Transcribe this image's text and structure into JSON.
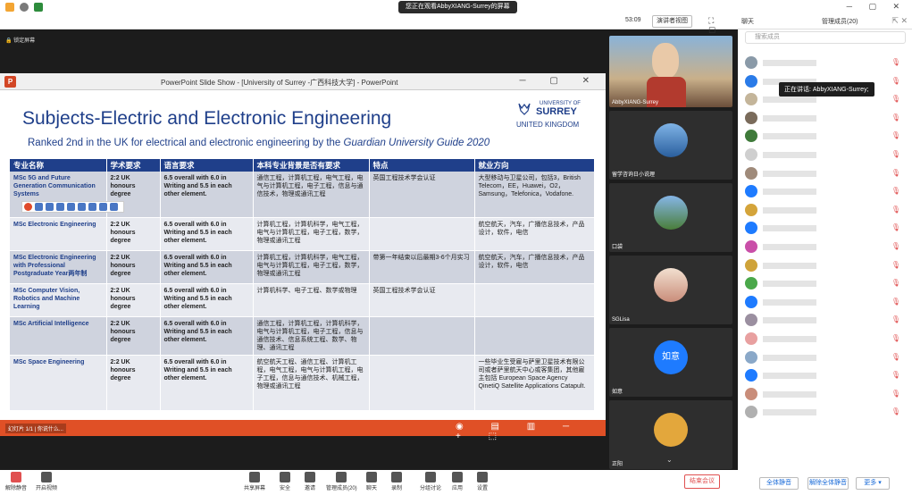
{
  "titlebar": {
    "center": "您正在观看AbbyXIANG-Surrey的屏幕",
    "controls": "─ ▢ ✕"
  },
  "toolbar": {
    "timer": "53:09",
    "layout": "演讲者视图",
    "icons": "⛶ ☐ ⋮"
  },
  "lock_label": "锁定屏幕",
  "ppt": {
    "window_title": "PowerPoint Slide Show - [University of Surrey -广西科技大学] - PowerPoint",
    "logo": "P",
    "controls": "─ ▢ ✕",
    "status_left": "幻灯片 1/1 | 你说什么...",
    "status_right": "◉ ▤ ▥ ─ + ⬚"
  },
  "slide": {
    "title": "Subjects-Electric and Electronic Engineering",
    "subtitle_main": "Ranked 2nd in the UK for electrical and electronic engineering by the ",
    "subtitle_italic": "Guardian University Guide 2020",
    "logo_univ": "UNIVERSITY OF",
    "logo_name": "SURREY",
    "logo_country": "UNITED KINGDOM",
    "headers": [
      "专业名称",
      "学术要求",
      "语言要求",
      "本科专业背景是否有要求",
      "特点",
      "就业方向"
    ],
    "rows": [
      [
        "MSc 5G and Future Generation Communication Systems",
        "2:2 UK honours degree",
        "6.5 overall with 6.0 in Writing and 5.5 in each other element.",
        "通信工程，计算机工程，电气工程，电气与计算机工程，电子工程，信息与通信技术，物理或通讯工程",
        "英国工程技术学会认证",
        "大型移动与卫星公司，包括3，British Telecom，EE，Huawei，O2，Samsung，Telefonica，Vodafone."
      ],
      [
        "MSc Electronic Engineering",
        "2:2 UK honours degree",
        "6.5 overall with 6.0 in Writing and 5.5 in each other element.",
        "计算机工程，计算机科学，电气工程，电气与计算机工程，电子工程，数学，物理或通讯工程",
        "",
        "航空航天，汽车，广播信息技术，产品设计，软件，电信"
      ],
      [
        "MSc Electronic Engineering with Professional Postgraduate Year两年制",
        "2:2 UK honours degree",
        "6.5 overall with 6.0 in Writing and 5.5 in each other element.",
        "计算机工程，计算机科学，电气工程，电气与计算机工程，电子工程，数学，物理或通讯工程",
        "带第一年结束以后最期3-6个月实习",
        "航空航天，汽车，广播信息技术，产品设计，软件，电信"
      ],
      [
        "MSc Computer Vision, Robotics and Machine Learning",
        "2:2 UK honours degree",
        "6.5 overall with 6.0 in Writing and 5.5 in each other element.",
        "计算机科学、电子工程、数学或物理",
        "英国工程技术学会认证",
        ""
      ],
      [
        "MSc Artificial Intelligence",
        "2:2 UK honours degree",
        "6.5 overall with 6.0 in Writing and 5.5 in each other element.",
        "通信工程，计算机工程，计算机科学，电气与计算机工程，电子工程，信息与通信技术、信息系统工程、数学、物理、通讯工程",
        "",
        ""
      ],
      [
        "MSc Space Engineering",
        "2:2 UK honours degree",
        "6.5 overall with 6.0 in Writing and 5.5 in each other element.",
        "航空航天工程、通信工程、计算机工程，电气工程，电气与计算机工程，电子工程，信息与通信技术、机械工程，物理或通讯工程",
        "",
        "一些毕业生受雇与萨里卫星技术有限公司或者萨里航天中心或客集团，其他雇主包括 European Space Agency QinetiQ Satellite Applications Catapult."
      ]
    ]
  },
  "videos": [
    {
      "name": "AbbyXIANG-Surrey"
    },
    {
      "name": "留学咨询日小说理"
    },
    {
      "name": "口袋"
    },
    {
      "name": "SGLisa"
    },
    {
      "name": "如意",
      "avatar_text": "如意"
    },
    {
      "name": "正阳"
    }
  ],
  "panel": {
    "chat_tab": "聊天",
    "members_tab": "管理成员(20)",
    "panel_controls": "⇱ ✕",
    "search_placeholder": "搜索成员",
    "speaking": "正在讲话: AbbyXIANG-Surrey;",
    "member_count": 20,
    "mute_all": "全体静音",
    "unmute_all": "解除全体静音",
    "more": "更多 ▾"
  },
  "bottom": {
    "items": [
      "解除静音",
      "开启视频",
      "共享屏幕",
      "安全",
      "邀请",
      "管理成员(20)",
      "聊天",
      "录制",
      "分组讨论",
      "应用",
      "设置"
    ],
    "end": "结束会议"
  }
}
